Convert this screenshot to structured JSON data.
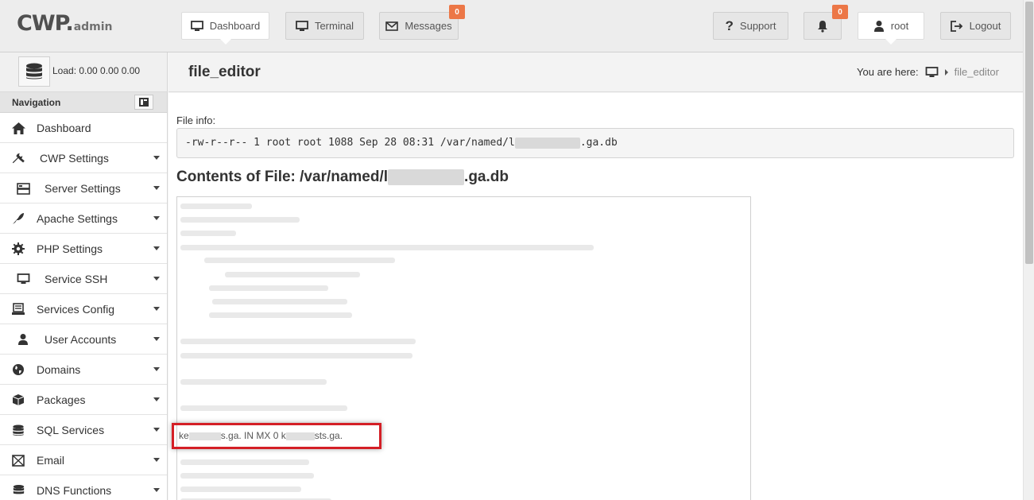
{
  "brand": {
    "main": "CWP",
    "dot": ".",
    "sub": "admin"
  },
  "topnav": {
    "dashboard": "Dashboard",
    "terminal": "Terminal",
    "messages": "Messages",
    "messages_badge": "0",
    "support": "Support",
    "notifications_badge": "0",
    "user": "root",
    "logout": "Logout"
  },
  "sidebar": {
    "load_label": "Load: 0.00  0.00  0.00",
    "nav_title": "Navigation",
    "items": [
      {
        "label": "Dashboard",
        "icon": "home-icon"
      },
      {
        "label": "CWP Settings",
        "icon": "wrench-icon"
      },
      {
        "label": "Server Settings",
        "icon": "server-icon"
      },
      {
        "label": "Apache Settings",
        "icon": "feather-icon"
      },
      {
        "label": "PHP Settings",
        "icon": "gear-icon"
      },
      {
        "label": "Service SSH",
        "icon": "monitor-icon"
      },
      {
        "label": "Services Config",
        "icon": "config-icon"
      },
      {
        "label": "User Accounts",
        "icon": "user-icon"
      },
      {
        "label": "Domains",
        "icon": "globe-icon"
      },
      {
        "label": "Packages",
        "icon": "package-icon"
      },
      {
        "label": "SQL Services",
        "icon": "database-icon"
      },
      {
        "label": "Email",
        "icon": "envelope-icon"
      },
      {
        "label": "DNS Functions",
        "icon": "dns-icon"
      }
    ]
  },
  "page": {
    "title": "file_editor",
    "breadcrumb_label": "You are here:",
    "breadcrumb_current": "file_editor"
  },
  "file": {
    "info_label": "File info:",
    "info_prefix": "-rw-r--r-- 1 root root 1088 Sep 28 08:31 /var/named/l",
    "info_suffix": ".ga.db",
    "contents_prefix": "Contents of File: /var/named/l",
    "contents_suffix": ".ga.db",
    "highlight_a": "ke",
    "highlight_b": "s.ga. IN MX 0 k",
    "highlight_c": "sts.ga."
  },
  "colors": {
    "badge": "#ec7747",
    "highlight_border": "#d41f26"
  }
}
